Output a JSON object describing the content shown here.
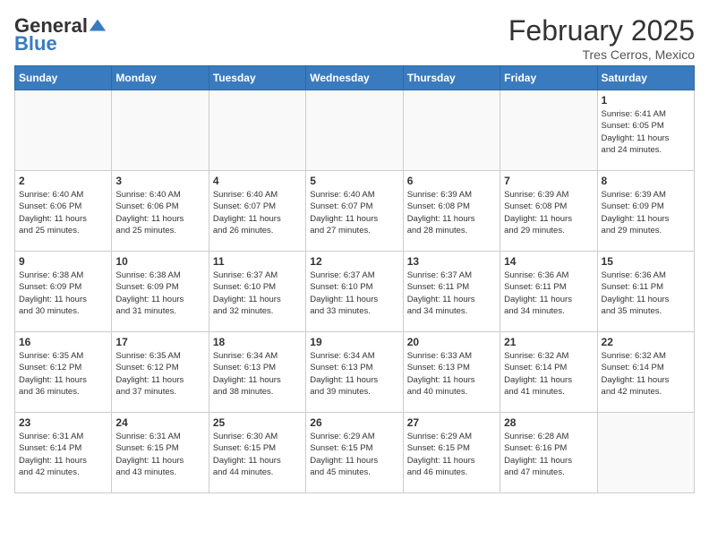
{
  "header": {
    "logo": {
      "general": "General",
      "blue": "Blue",
      "logo_alt": "GeneralBlue logo"
    },
    "title": "February 2025",
    "location": "Tres Cerros, Mexico"
  },
  "days_of_week": [
    "Sunday",
    "Monday",
    "Tuesday",
    "Wednesday",
    "Thursday",
    "Friday",
    "Saturday"
  ],
  "weeks": [
    [
      {
        "day": "",
        "info": ""
      },
      {
        "day": "",
        "info": ""
      },
      {
        "day": "",
        "info": ""
      },
      {
        "day": "",
        "info": ""
      },
      {
        "day": "",
        "info": ""
      },
      {
        "day": "",
        "info": ""
      },
      {
        "day": "1",
        "info": "Sunrise: 6:41 AM\nSunset: 6:05 PM\nDaylight: 11 hours\nand 24 minutes."
      }
    ],
    [
      {
        "day": "2",
        "info": "Sunrise: 6:40 AM\nSunset: 6:06 PM\nDaylight: 11 hours\nand 25 minutes."
      },
      {
        "day": "3",
        "info": "Sunrise: 6:40 AM\nSunset: 6:06 PM\nDaylight: 11 hours\nand 25 minutes."
      },
      {
        "day": "4",
        "info": "Sunrise: 6:40 AM\nSunset: 6:07 PM\nDaylight: 11 hours\nand 26 minutes."
      },
      {
        "day": "5",
        "info": "Sunrise: 6:40 AM\nSunset: 6:07 PM\nDaylight: 11 hours\nand 27 minutes."
      },
      {
        "day": "6",
        "info": "Sunrise: 6:39 AM\nSunset: 6:08 PM\nDaylight: 11 hours\nand 28 minutes."
      },
      {
        "day": "7",
        "info": "Sunrise: 6:39 AM\nSunset: 6:08 PM\nDaylight: 11 hours\nand 29 minutes."
      },
      {
        "day": "8",
        "info": "Sunrise: 6:39 AM\nSunset: 6:09 PM\nDaylight: 11 hours\nand 29 minutes."
      }
    ],
    [
      {
        "day": "9",
        "info": "Sunrise: 6:38 AM\nSunset: 6:09 PM\nDaylight: 11 hours\nand 30 minutes."
      },
      {
        "day": "10",
        "info": "Sunrise: 6:38 AM\nSunset: 6:09 PM\nDaylight: 11 hours\nand 31 minutes."
      },
      {
        "day": "11",
        "info": "Sunrise: 6:37 AM\nSunset: 6:10 PM\nDaylight: 11 hours\nand 32 minutes."
      },
      {
        "day": "12",
        "info": "Sunrise: 6:37 AM\nSunset: 6:10 PM\nDaylight: 11 hours\nand 33 minutes."
      },
      {
        "day": "13",
        "info": "Sunrise: 6:37 AM\nSunset: 6:11 PM\nDaylight: 11 hours\nand 34 minutes."
      },
      {
        "day": "14",
        "info": "Sunrise: 6:36 AM\nSunset: 6:11 PM\nDaylight: 11 hours\nand 34 minutes."
      },
      {
        "day": "15",
        "info": "Sunrise: 6:36 AM\nSunset: 6:11 PM\nDaylight: 11 hours\nand 35 minutes."
      }
    ],
    [
      {
        "day": "16",
        "info": "Sunrise: 6:35 AM\nSunset: 6:12 PM\nDaylight: 11 hours\nand 36 minutes."
      },
      {
        "day": "17",
        "info": "Sunrise: 6:35 AM\nSunset: 6:12 PM\nDaylight: 11 hours\nand 37 minutes."
      },
      {
        "day": "18",
        "info": "Sunrise: 6:34 AM\nSunset: 6:13 PM\nDaylight: 11 hours\nand 38 minutes."
      },
      {
        "day": "19",
        "info": "Sunrise: 6:34 AM\nSunset: 6:13 PM\nDaylight: 11 hours\nand 39 minutes."
      },
      {
        "day": "20",
        "info": "Sunrise: 6:33 AM\nSunset: 6:13 PM\nDaylight: 11 hours\nand 40 minutes."
      },
      {
        "day": "21",
        "info": "Sunrise: 6:32 AM\nSunset: 6:14 PM\nDaylight: 11 hours\nand 41 minutes."
      },
      {
        "day": "22",
        "info": "Sunrise: 6:32 AM\nSunset: 6:14 PM\nDaylight: 11 hours\nand 42 minutes."
      }
    ],
    [
      {
        "day": "23",
        "info": "Sunrise: 6:31 AM\nSunset: 6:14 PM\nDaylight: 11 hours\nand 42 minutes."
      },
      {
        "day": "24",
        "info": "Sunrise: 6:31 AM\nSunset: 6:15 PM\nDaylight: 11 hours\nand 43 minutes."
      },
      {
        "day": "25",
        "info": "Sunrise: 6:30 AM\nSunset: 6:15 PM\nDaylight: 11 hours\nand 44 minutes."
      },
      {
        "day": "26",
        "info": "Sunrise: 6:29 AM\nSunset: 6:15 PM\nDaylight: 11 hours\nand 45 minutes."
      },
      {
        "day": "27",
        "info": "Sunrise: 6:29 AM\nSunset: 6:15 PM\nDaylight: 11 hours\nand 46 minutes."
      },
      {
        "day": "28",
        "info": "Sunrise: 6:28 AM\nSunset: 6:16 PM\nDaylight: 11 hours\nand 47 minutes."
      },
      {
        "day": "",
        "info": ""
      }
    ]
  ]
}
